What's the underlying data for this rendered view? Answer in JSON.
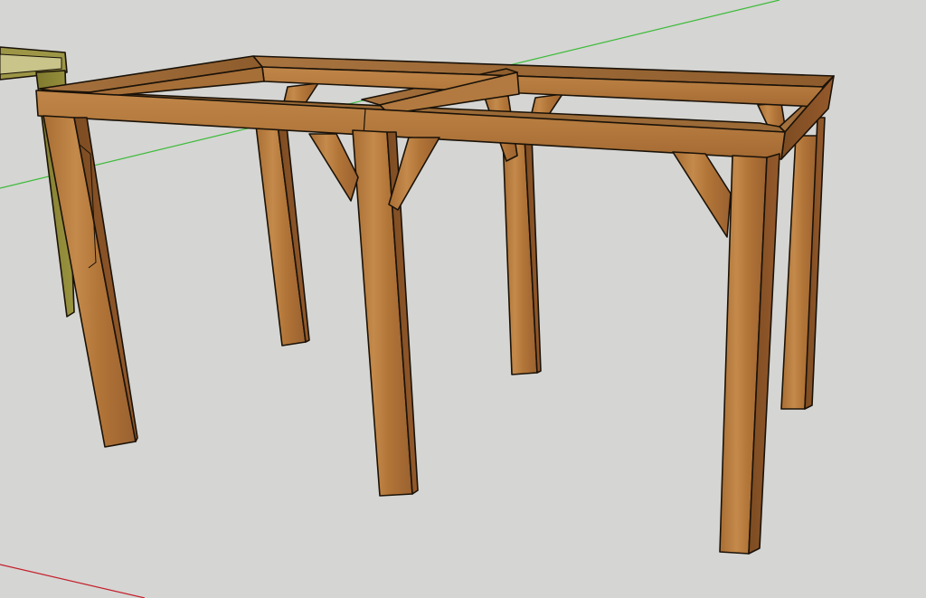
{
  "scene": {
    "background_color": "#d5d5d3",
    "wood_color_light": "#b9803f",
    "wood_color_dark": "#8a5626",
    "neighbor_color": "#8c8536",
    "axis_green": "#3dbb3a",
    "axis_red": "#c41e2a",
    "edge_color": "#1a1208"
  },
  "objects": {
    "frame": "wooden-table-frame",
    "neighbor": "adjacent-table-frame",
    "axes": [
      "green-axis",
      "red-axis"
    ]
  }
}
